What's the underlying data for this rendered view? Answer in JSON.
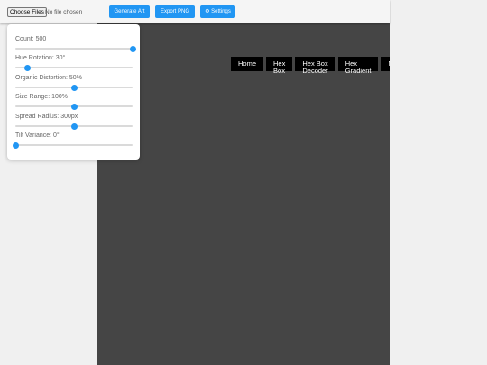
{
  "toolbar": {
    "file_button": "Choose Files",
    "file_status": "No file chosen",
    "generate_label": "Generate Art",
    "export_label": "Export PNG",
    "settings_label": "⚙ Settings"
  },
  "nav": {
    "items": [
      "Home",
      "Hex Box",
      "Hex Box Decoder",
      "Hex Gradient",
      "Music"
    ]
  },
  "controls": [
    {
      "label": "Count: 500",
      "fraction": 1.0
    },
    {
      "label": "Hue Rotation: 30°",
      "fraction": 0.1
    },
    {
      "label": "Organic Distortion: 50%",
      "fraction": 0.5
    },
    {
      "label": "Size Range: 100%",
      "fraction": 0.5
    },
    {
      "label": "Spread Radius: 300px",
      "fraction": 0.5
    },
    {
      "label": "Tilt Variance: 0°",
      "fraction": 0.0
    }
  ],
  "colors": {
    "accent": "#2196f3",
    "canvas_bg": "#454545",
    "nav_bg": "#000000",
    "title_art": "#b02b3b"
  }
}
